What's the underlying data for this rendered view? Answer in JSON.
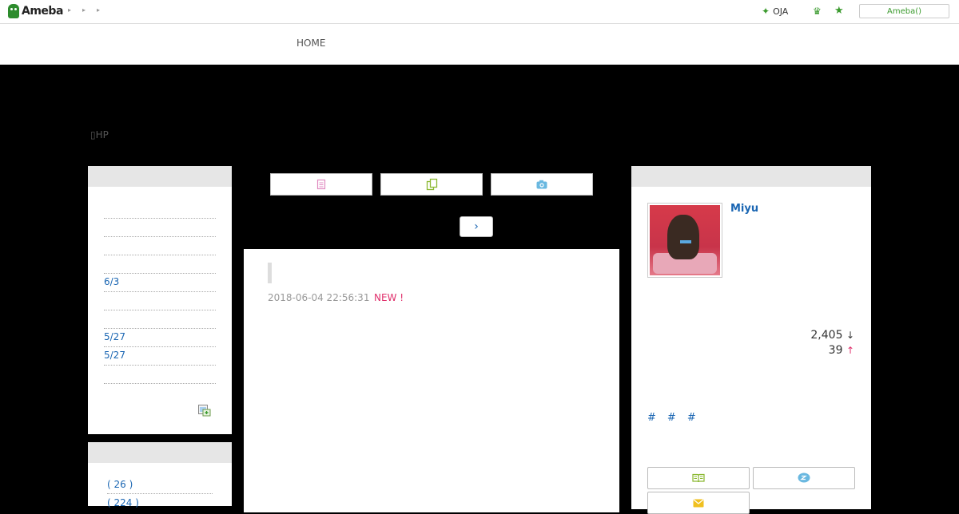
{
  "header": {
    "logo_text": "Ameba",
    "breadcrumb_arrows": [
      "▸",
      "▸",
      "▸"
    ],
    "oja_label": "OJA",
    "ameba_button": "Ameba()"
  },
  "nav": {
    "home_label": "HOME"
  },
  "blog": {
    "hp_label": "▯HP"
  },
  "left_sidebar": {
    "entries": [
      "",
      "",
      "",
      "6/3",
      "",
      "5/27",
      "5/27",
      "",
      ""
    ],
    "themes": [
      "( 26 )",
      "( 224 )"
    ]
  },
  "post": {
    "date": "2018-06-04 22:56:31",
    "new_badge": "NEW !",
    "next_arrow": "›"
  },
  "profile": {
    "name": "Miyu",
    "readers": "2,405",
    "readers_trend": "↓",
    "rank": "39",
    "rank_trend": "↑",
    "hashtags": [
      "#",
      "#",
      "#"
    ]
  },
  "colors": {
    "link": "#1a66b3",
    "new": "#e0306c",
    "ameba_green": "#3a9a2d"
  }
}
